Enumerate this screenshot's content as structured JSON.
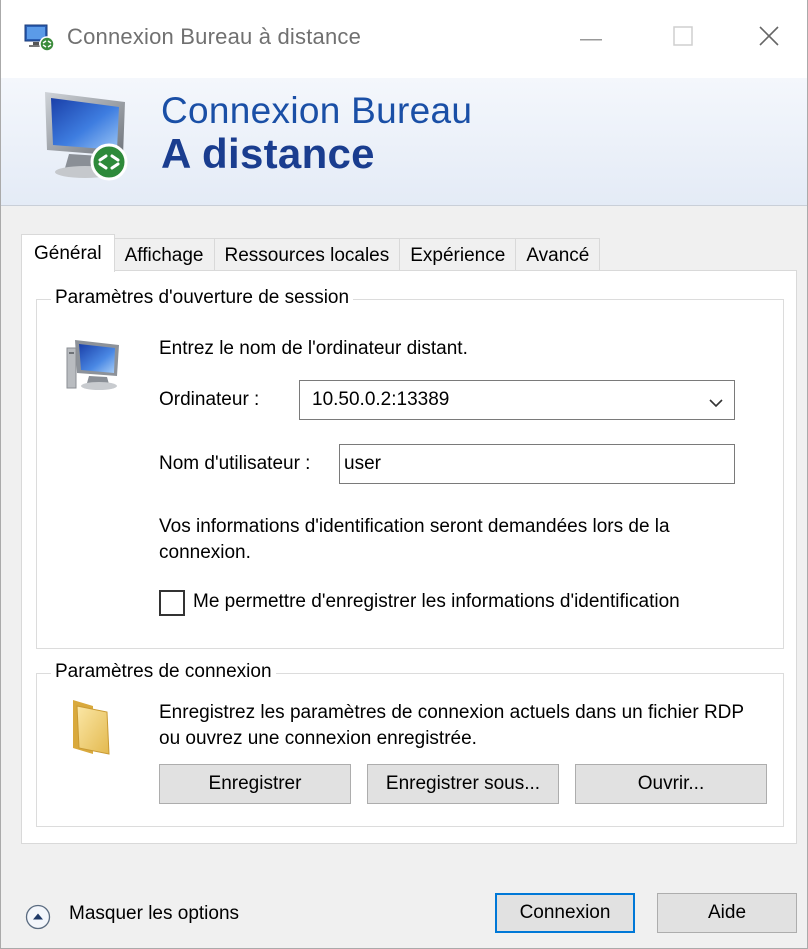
{
  "window": {
    "title": "Connexion Bureau à distance"
  },
  "banner": {
    "line1": "Connexion Bureau",
    "line2": "A distance"
  },
  "tabs": [
    {
      "label": "Général",
      "active": true
    },
    {
      "label": "Affichage",
      "active": false
    },
    {
      "label": "Ressources locales",
      "active": false
    },
    {
      "label": "Expérience",
      "active": false
    },
    {
      "label": "Avancé",
      "active": false
    }
  ],
  "session": {
    "legend": "Paramètres d'ouverture de session",
    "instruction": "Entrez le nom de l'ordinateur distant.",
    "computer_label": "Ordinateur :",
    "computer_value": "10.50.0.2:13389",
    "username_label": "Nom d'utilisateur :",
    "username_value": "user",
    "credentials_note": "Vos informations d'identification seront demandées lors de la connexion.",
    "save_credentials_label": "Me permettre d'enregistrer les informations d'identification",
    "save_credentials_checked": false
  },
  "connection": {
    "legend": "Paramètres de connexion",
    "description": "Enregistrez les paramètres de connexion actuels dans un fichier RDP ou ouvrez une connexion enregistrée.",
    "save_label": "Enregistrer",
    "save_as_label": "Enregistrer sous...",
    "open_label": "Ouvrir..."
  },
  "footer": {
    "hide_options_label": "Masquer les options",
    "connect_label": "Connexion",
    "help_label": "Aide"
  },
  "icons": {
    "app": "remote-desktop-icon",
    "minimize": "minimize-icon",
    "maximize": "maximize-icon",
    "close": "close-icon",
    "computer": "computer-icon",
    "folder": "folder-icon",
    "dropdown": "chevron-down-icon",
    "toggle": "chevron-up-circle-icon"
  },
  "colors": {
    "banner_title": "#1a4fa6",
    "banner_title_bold": "#1a3d8f",
    "title_text": "#707070"
  }
}
